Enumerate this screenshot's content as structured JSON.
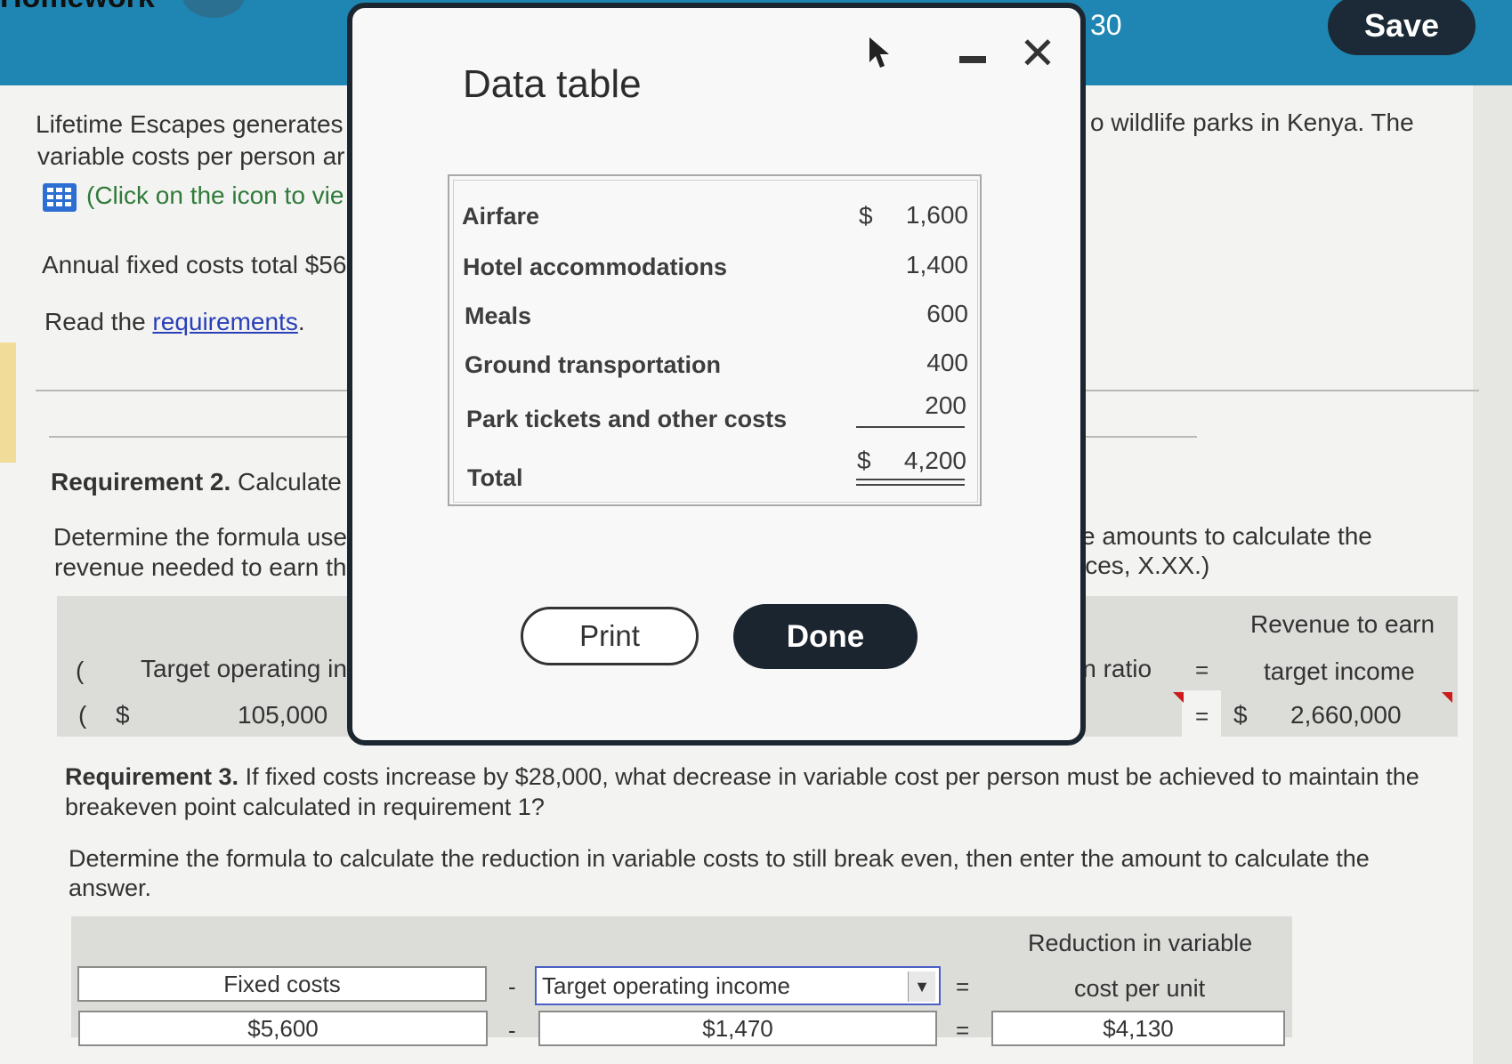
{
  "header": {
    "logo_text": "Homework",
    "score": "30",
    "save_label": "Save"
  },
  "problem": {
    "line1": "Lifetime Escapes generates",
    "line1_right": "o wildlife parks in Kenya. The",
    "line2": "variable costs per person ar",
    "icon_hint": "(Click on the icon to vie",
    "fixed_costs_text": "Annual fixed costs total $56",
    "read_prefix": "Read the ",
    "read_link": "requirements",
    "read_suffix": "."
  },
  "req2": {
    "title_bold": "Requirement 2.",
    "title_rest": " Calculate t",
    "det_line1": "Determine the formula used",
    "det_line1_right": "e amounts to calculate the",
    "det_line2": "revenue needed to earn the",
    "det_line2_right": "ices, X.XX.)",
    "open_paren": "(",
    "target_label": "Target operating inco",
    "ratio_label": "in ratio",
    "equals": "=",
    "result_header_1": "Revenue to earn",
    "result_header_2": "target income",
    "currency": "$",
    "target_value": "105,000",
    "result_value": "2,660,000"
  },
  "req3": {
    "title_bold": "Requirement 3.",
    "title_rest": " If fixed costs increase by $28,000, what decrease in variable cost per person must be achieved to maintain the",
    "title_line2": "breakeven point calculated in requirement 1?",
    "det_line1": "Determine the formula to calculate the reduction in variable costs to still break even, then enter the amount to calculate the",
    "det_line2": "answer.",
    "minus": "-",
    "equals": "=",
    "col1_label": "Fixed costs",
    "col2_selected": "Target operating income",
    "result_header_1": "Reduction in variable",
    "result_header_2": "cost per unit",
    "col1_value": "$5,600",
    "col2_value": "$1,470",
    "result_value": "$4,130"
  },
  "modal": {
    "title": "Data table",
    "currency": "$",
    "rows": [
      {
        "label": "Airfare",
        "value": "1,600"
      },
      {
        "label": "Hotel accommodations",
        "value": "1,400"
      },
      {
        "label": "Meals",
        "value": "600"
      },
      {
        "label": "Ground transportation",
        "value": "400"
      },
      {
        "label": "Park tickets and other costs",
        "value": "200"
      }
    ],
    "total_label": "Total",
    "total_value": "4,200",
    "print_label": "Print",
    "done_label": "Done"
  },
  "icons": [
    "grid-icon",
    "minimize-icon",
    "close-icon",
    "cursor-icon",
    "dropdown-arrow-icon"
  ],
  "colors": {
    "header_bg": "#1f86b3",
    "save_bg": "#1b2a36",
    "link": "#2a3fb8",
    "done_bg": "#1b2530"
  }
}
